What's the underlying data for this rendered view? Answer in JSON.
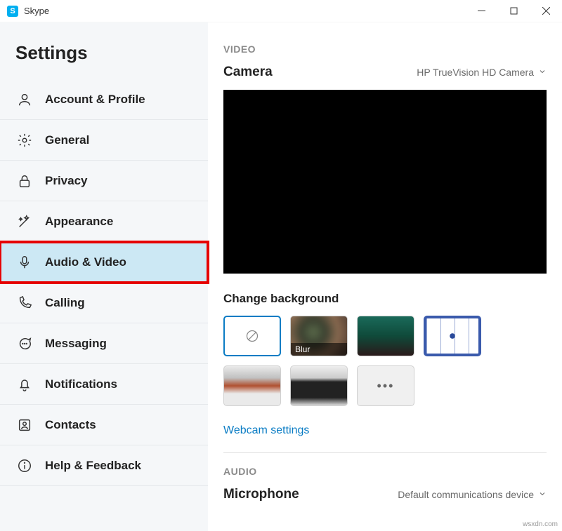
{
  "window": {
    "title": "Skype",
    "app_icon_letter": "S"
  },
  "sidebar": {
    "title": "Settings",
    "items": [
      {
        "label": "Account & Profile"
      },
      {
        "label": "General"
      },
      {
        "label": "Privacy"
      },
      {
        "label": "Appearance"
      },
      {
        "label": "Audio & Video"
      },
      {
        "label": "Calling"
      },
      {
        "label": "Messaging"
      },
      {
        "label": "Notifications"
      },
      {
        "label": "Contacts"
      },
      {
        "label": "Help & Feedback"
      }
    ]
  },
  "main": {
    "video_heading": "VIDEO",
    "camera_label": "Camera",
    "camera_value": "HP TrueVision HD Camera",
    "change_bg_label": "Change background",
    "blur_caption": "Blur",
    "more_dots": "•••",
    "webcam_settings": "Webcam settings",
    "audio_heading": "AUDIO",
    "microphone_label": "Microphone",
    "microphone_value": "Default communications device"
  },
  "watermark": "wsxdn.com"
}
